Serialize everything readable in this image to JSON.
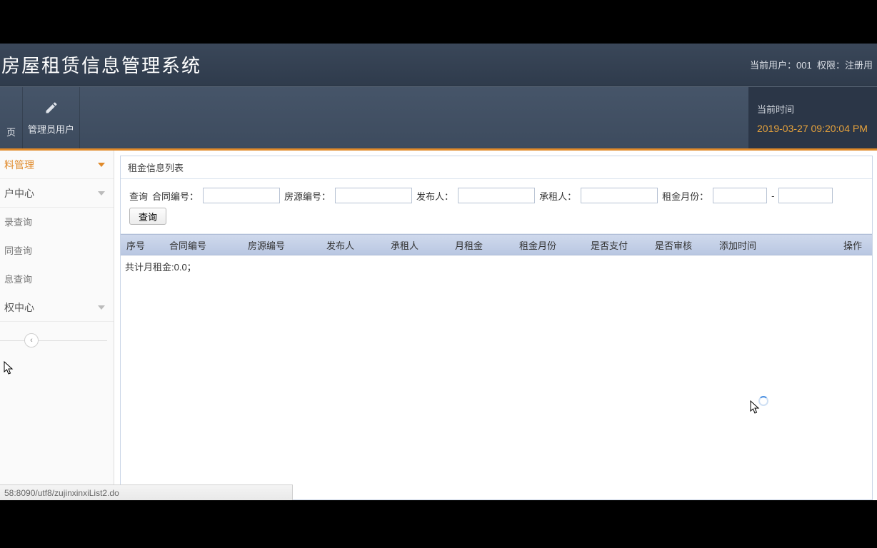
{
  "header": {
    "title": "房屋租赁信息管理系统",
    "user_label": "当前用户：",
    "user": "001",
    "perm_label": "权限：",
    "perm": "注册用"
  },
  "toolbar": {
    "item0": "页",
    "item1": "管理员用户"
  },
  "timebox": {
    "label": "当前时间",
    "clock": "2019-03-27 09:20:04 PM"
  },
  "sidebar": {
    "group1": "料管理",
    "group2": "户中心",
    "item1": "录查询",
    "item2": "同查询",
    "item3": "息查询",
    "group3": "权中心"
  },
  "panel": {
    "title": "租金信息列表",
    "search_label": "查询",
    "f_contract": "合同编号：",
    "f_house": "房源编号：",
    "f_publisher": "发布人：",
    "f_tenant": "承租人：",
    "f_month": "租金月份：",
    "dash": "-",
    "btn": "查询"
  },
  "columns": {
    "seq": "序号",
    "contract": "合同编号",
    "house": "房源编号",
    "publisher": "发布人",
    "tenant": "承租人",
    "rent": "月租金",
    "month": "租金月份",
    "paid": "是否支付",
    "reviewed": "是否审核",
    "addtime": "添加时间",
    "operate": "操作"
  },
  "summary": "共计月租金:0.0；",
  "statusbar": "58:8090/utf8/zujinxinxiList2.do"
}
